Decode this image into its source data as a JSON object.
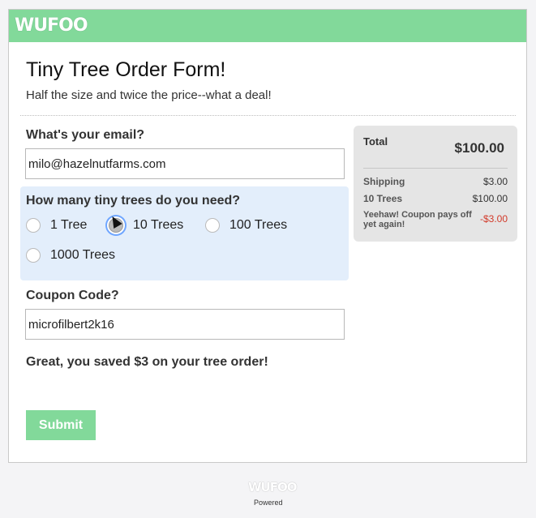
{
  "brand": {
    "logo_text": "WUFOO",
    "brand_color": "#82d99a"
  },
  "form": {
    "title": "Tiny Tree Order Form!",
    "subtitle": "Half the size and twice the price--what a deal!",
    "email": {
      "label": "What's your email?",
      "value": "milo@hazelnutfarms.com"
    },
    "trees": {
      "label": "How many tiny trees do you need?",
      "options": [
        "1 Tree",
        "10 Trees",
        "100 Trees",
        "1000 Trees"
      ],
      "selected": "10 Trees"
    },
    "coupon": {
      "label": "Coupon Code?",
      "value": "microfilbert2k16"
    },
    "saved_message": "Great, you saved $3 on your tree order!",
    "submit_label": "Submit"
  },
  "summary": {
    "total_label": "Total",
    "total_value": "$100.00",
    "rows": [
      {
        "label": "Shipping",
        "value": "$3.00"
      },
      {
        "label": "10 Trees",
        "value": "$100.00"
      }
    ],
    "coupon_row": {
      "label": "Yeehaw! Coupon pays off yet again!",
      "value": "-$3.00"
    }
  },
  "footer": {
    "logo_text": "WUFOO",
    "powered": "Powered"
  }
}
